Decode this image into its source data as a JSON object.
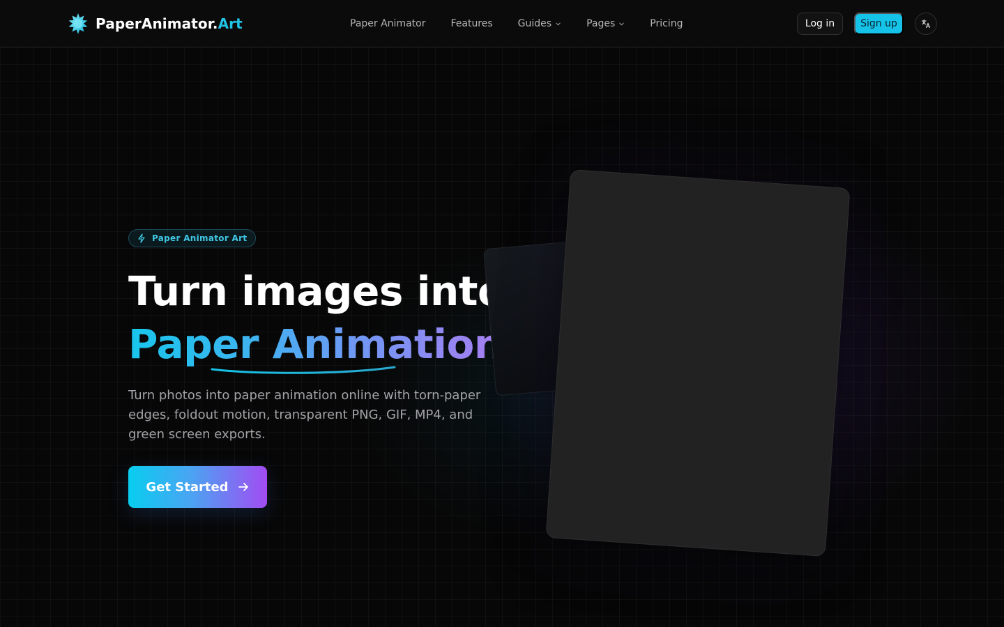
{
  "header": {
    "logo_main": "PaperAnimator.",
    "logo_accent": "Art",
    "nav": [
      {
        "label": "Paper Animator"
      },
      {
        "label": "Features"
      },
      {
        "label": "Guides"
      },
      {
        "label": "Pages"
      },
      {
        "label": "Pricing"
      }
    ],
    "login_label": "Log in",
    "signup_label": "Sign up"
  },
  "hero": {
    "badge": "Paper Animator Art",
    "title_line1": "Turn images into",
    "title_line2": "Paper Animation",
    "description": "Turn photos into paper animation online with torn-paper edges, foldout motion, transparent PNG, GIF, MP4, and green screen exports.",
    "cta_label": "Get Started"
  },
  "colors": {
    "accent": "#16c3e8",
    "gradient_start": "#08cdf0",
    "gradient_end": "#a24cf2",
    "background": "#070707"
  },
  "icons": {
    "logo": "sunburst-logo-icon",
    "badge": "lightning-icon",
    "cta": "arrow-right-icon",
    "language": "translate-icon",
    "dropdown": "chevron-down-icon"
  }
}
